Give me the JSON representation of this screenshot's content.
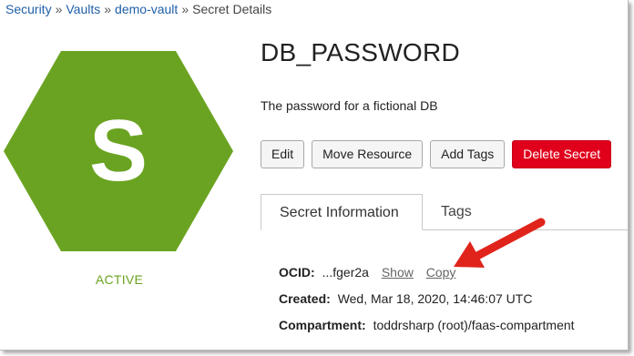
{
  "breadcrumb": {
    "items": [
      "Security",
      "Vaults",
      "demo-vault"
    ],
    "separator": "»",
    "current": "Secret Details"
  },
  "avatar": {
    "letter": "S",
    "color": "#6aa321",
    "status": "ACTIVE"
  },
  "secret": {
    "name": "DB_PASSWORD",
    "description": "The password for a fictional DB"
  },
  "actions": {
    "edit": "Edit",
    "move": "Move Resource",
    "add_tags": "Add Tags",
    "delete": "Delete Secret"
  },
  "tabs": [
    "Secret Information",
    "Tags"
  ],
  "info": {
    "ocid_label": "OCID:",
    "ocid_value": "...fger2a",
    "show": "Show",
    "copy": "Copy",
    "created_label": "Created:",
    "created_value": "Wed, Mar 18, 2020, 14:46:07 UTC",
    "compartment_label": "Compartment:",
    "compartment_value": "toddrsharp (root)/faas-compartment"
  },
  "annotation": {
    "icon": "red-arrow-icon",
    "color": "#e0241b"
  }
}
